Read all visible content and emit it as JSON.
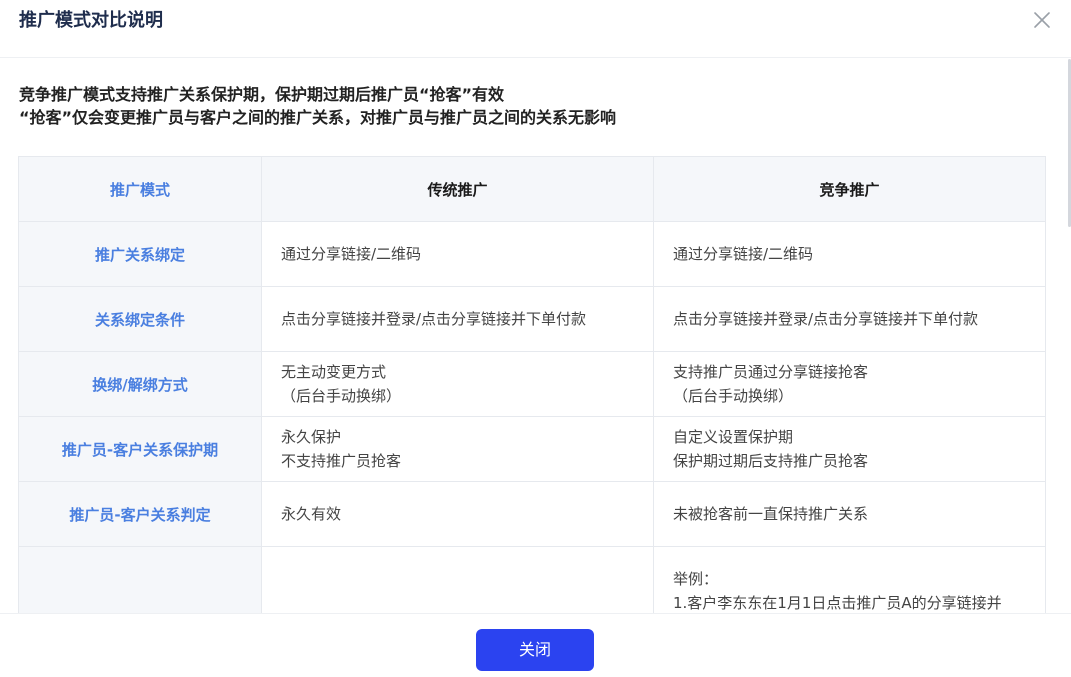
{
  "dialog": {
    "title": "推广模式对比说明",
    "close_icon": "close-icon"
  },
  "intro": {
    "line1": "竞争推广模式支持推广关系保护期，保护期过期后推广员“抢客”有效",
    "line2": "“抢客”仅会变更推广员与客户之间的推广关系，对推广员与推广员之间的关系无影响"
  },
  "table": {
    "headers": [
      "推广模式",
      "传统推广",
      "竞争推广"
    ],
    "rows": [
      {
        "label": "推广关系绑定",
        "traditional": [
          "通过分享链接/二维码"
        ],
        "competitive": [
          "通过分享链接/二维码"
        ]
      },
      {
        "label": "关系绑定条件",
        "traditional": [
          "点击分享链接并登录/点击分享链接并下单付款"
        ],
        "competitive": [
          "点击分享链接并登录/点击分享链接并下单付款"
        ]
      },
      {
        "label": "换绑/解绑方式",
        "traditional": [
          "无主动变更方式",
          "（后台手动换绑）"
        ],
        "competitive": [
          "支持推广员通过分享链接抢客",
          "（后台手动换绑）"
        ]
      },
      {
        "label": "推广员-客户关系保护期",
        "traditional": [
          "永久保护",
          "不支持推广员抢客"
        ],
        "competitive": [
          "自定义设置保护期",
          "保护期过期后支持推广员抢客"
        ]
      },
      {
        "label": "推广员-客户关系判定",
        "traditional": [
          "永久有效"
        ],
        "competitive": [
          "未被抢客前一直保持推广关系"
        ]
      },
      {
        "label": "",
        "traditional": [],
        "competitive": [
          "举例：",
          "1.客户李东东在1月1日点击推广员A的分享链接并"
        ]
      }
    ]
  },
  "footer": {
    "close_label": "关闭"
  },
  "colors": {
    "accent": "#2b43f0",
    "label_blue": "#4a7fe0",
    "header_bg": "#f5f7fa",
    "border": "#e6e9ee"
  }
}
